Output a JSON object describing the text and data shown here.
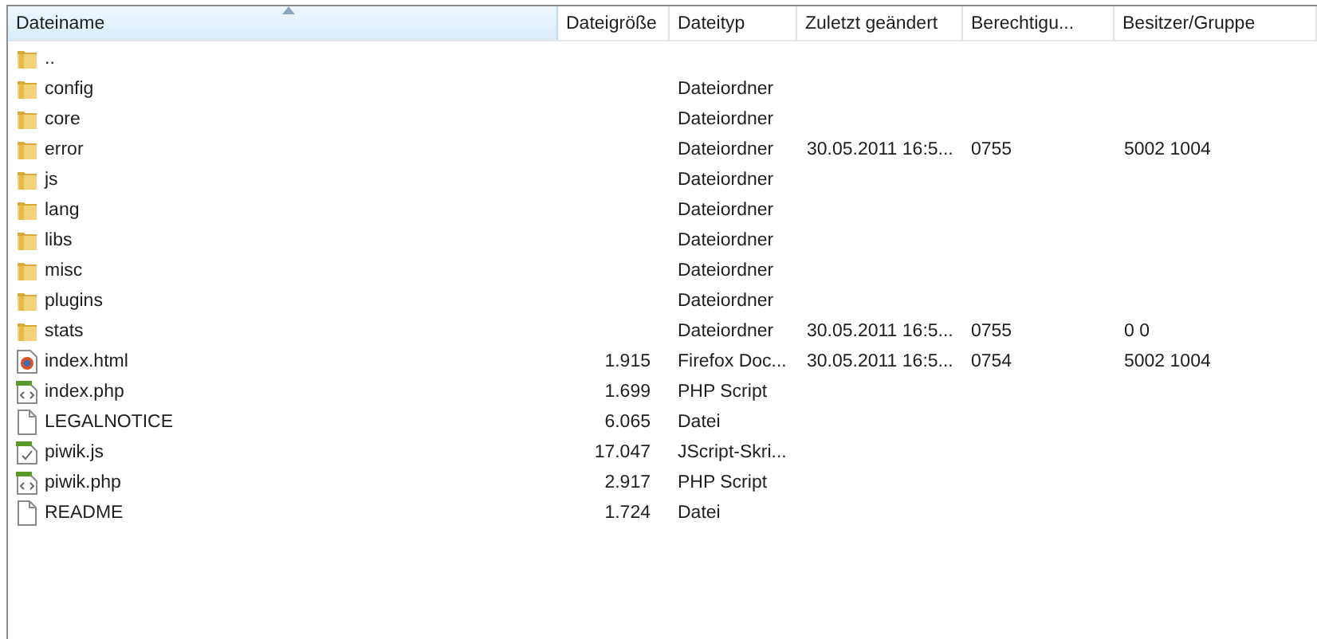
{
  "columns": [
    {
      "label": "Dateiname",
      "sorted": true
    },
    {
      "label": "Dateigröße",
      "sorted": false
    },
    {
      "label": "Dateityp",
      "sorted": false
    },
    {
      "label": "Zuletzt geändert",
      "sorted": false
    },
    {
      "label": "Berechtigu...",
      "sorted": false
    },
    {
      "label": "Besitzer/Gruppe",
      "sorted": false
    }
  ],
  "rows": [
    {
      "kind": "folder",
      "name": ".."
    },
    {
      "kind": "folder",
      "name": "config",
      "type": "Dateiordner"
    },
    {
      "kind": "folder",
      "name": "core",
      "type": "Dateiordner"
    },
    {
      "kind": "folder",
      "name": "error",
      "type": "Dateiordner",
      "modified": "30.05.2011 16:5...",
      "permissions": "0755",
      "owner": "5002 1004"
    },
    {
      "kind": "folder",
      "name": "js",
      "type": "Dateiordner"
    },
    {
      "kind": "folder",
      "name": "lang",
      "type": "Dateiordner"
    },
    {
      "kind": "folder",
      "name": "libs",
      "type": "Dateiordner"
    },
    {
      "kind": "folder",
      "name": "misc",
      "type": "Dateiordner"
    },
    {
      "kind": "folder",
      "name": "plugins",
      "type": "Dateiordner"
    },
    {
      "kind": "folder",
      "name": "stats",
      "type": "Dateiordner",
      "modified": "30.05.2011 16:5...",
      "permissions": "0755",
      "owner": "0 0"
    },
    {
      "kind": "browser",
      "name": "index.html",
      "size": "1.915",
      "type": "Firefox Doc...",
      "modified": "30.05.2011 16:5...",
      "permissions": "0754",
      "owner": "5002 1004"
    },
    {
      "kind": "php",
      "name": "index.php",
      "size": "1.699",
      "type": "PHP Script"
    },
    {
      "kind": "file",
      "name": "LEGALNOTICE",
      "size": "6.065",
      "type": "Datei"
    },
    {
      "kind": "script",
      "name": "piwik.js",
      "size": "17.047",
      "type": "JScript-Skri..."
    },
    {
      "kind": "php",
      "name": "piwik.php",
      "size": "2.917",
      "type": "PHP Script"
    },
    {
      "kind": "file",
      "name": "README",
      "size": "1.724",
      "type": "Datei"
    }
  ]
}
